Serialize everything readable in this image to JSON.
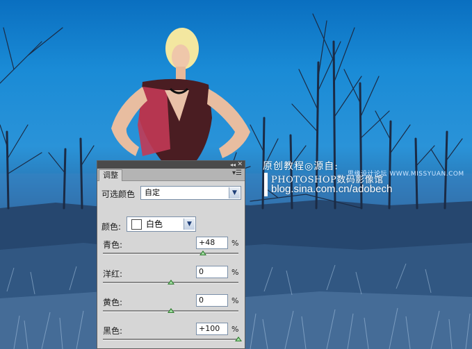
{
  "watermark": {
    "line1": "原创教程◎源自:",
    "line2": "PHOTOSHOP数码影像馆",
    "line3": "blog.sina.com.cn/adobech",
    "site": "思缘设计论坛 WWW.MISSYUAN.COM"
  },
  "panel": {
    "tab_label": "调整",
    "collapse_icon": "double-chevron-right-icon",
    "close_icon": "close-icon",
    "menu_icon": "panel-menu-icon",
    "preset_label": "可选颜色",
    "preset_value": "自定",
    "colors_label": "颜色:",
    "colors_value": "白色",
    "swatch_color": "#ffffff",
    "percent_sign": "%",
    "sliders": [
      {
        "label": "青色:",
        "value": "+48",
        "fraction": 0.74
      },
      {
        "label": "洋红:",
        "value": "0",
        "fraction": 0.5
      },
      {
        "label": "黄色:",
        "value": "0",
        "fraction": 0.5
      },
      {
        "label": "黑色:",
        "value": "+100",
        "fraction": 1.0
      }
    ]
  },
  "colors": {
    "sky_top": "#0a6fc0",
    "ground": "#1f3f6e",
    "panel_bg": "#d6d6d6",
    "thumb": "#2e7d2e"
  }
}
